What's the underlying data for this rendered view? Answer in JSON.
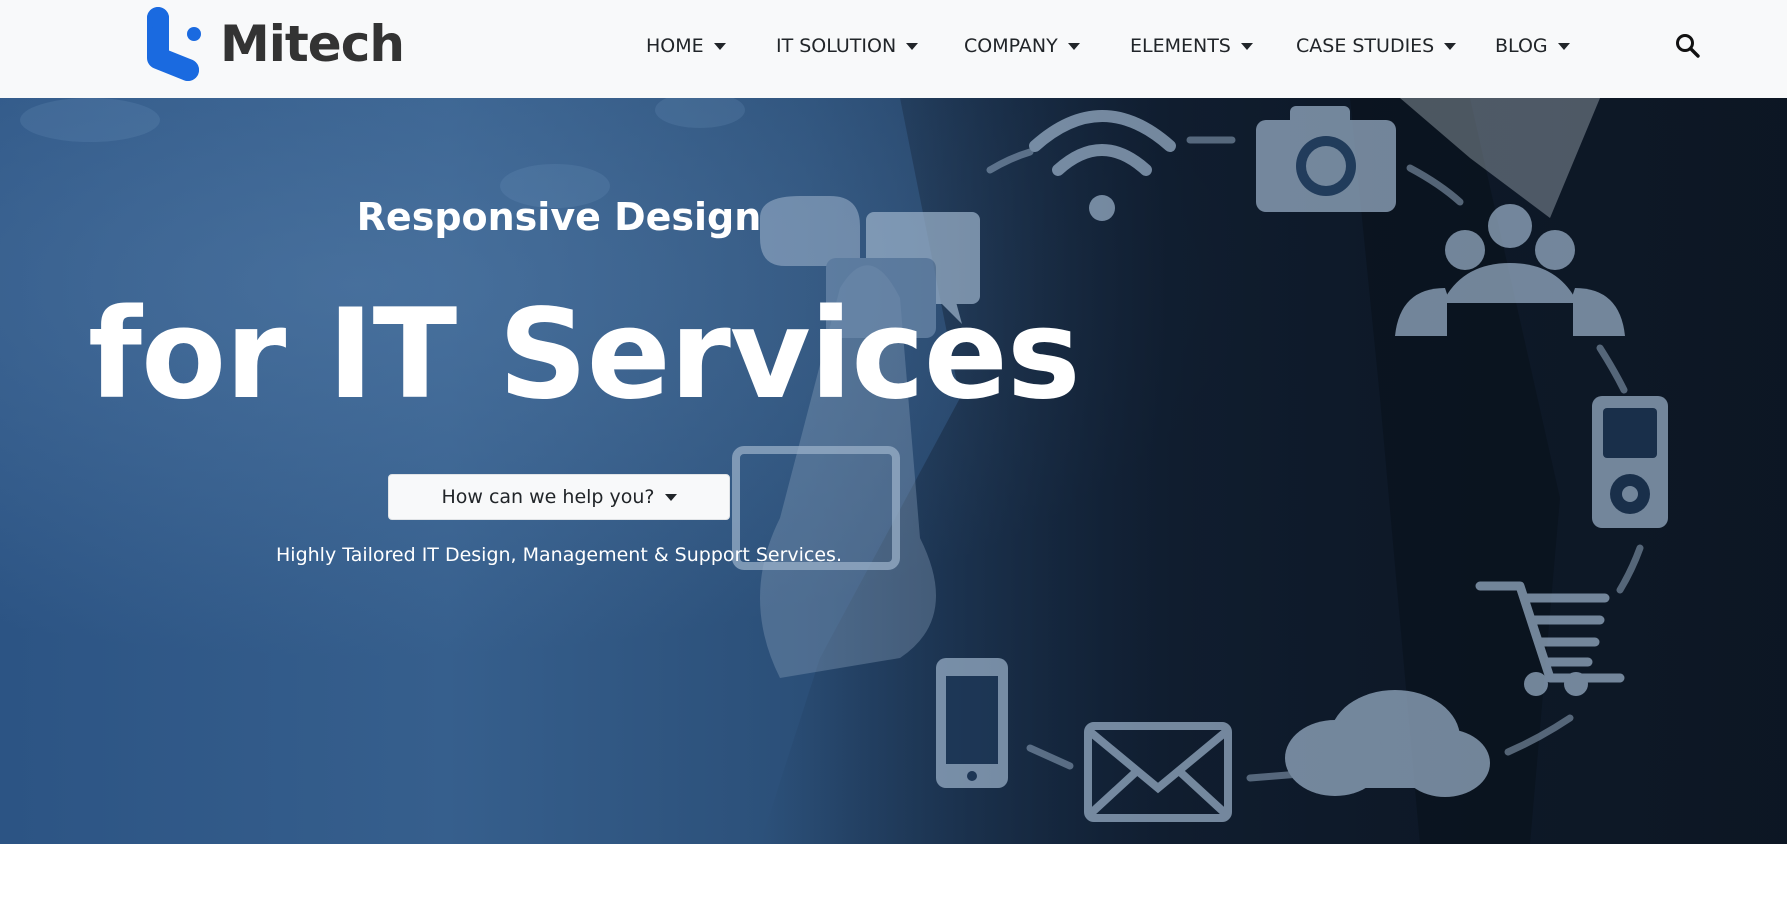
{
  "brand": {
    "name": "Mitech",
    "color": "#1a6ae0"
  },
  "nav": {
    "items": [
      {
        "label": "HOME"
      },
      {
        "label": "IT SOLUTION"
      },
      {
        "label": "COMPANY"
      },
      {
        "label": "ELEMENTS"
      },
      {
        "label": "CASE STUDIES"
      },
      {
        "label": "BLOG"
      }
    ],
    "search_icon": "search-icon"
  },
  "hero": {
    "subtitle": "Responsive Design",
    "title": "for IT Services",
    "cta_label": "How can we help you?",
    "tagline": "Highly Tailored IT Design, Management & Support Services.",
    "background_icons": [
      "wifi-icon",
      "camera-icon",
      "users-icon",
      "chat-icon",
      "media-player-icon",
      "cart-icon",
      "cloud-icon",
      "mail-icon",
      "phone-icon",
      "tablet-icon"
    ]
  },
  "colors": {
    "header_bg": "#f8f9fa",
    "hero_blue": "#2c5484",
    "text_dark": "#212529"
  }
}
